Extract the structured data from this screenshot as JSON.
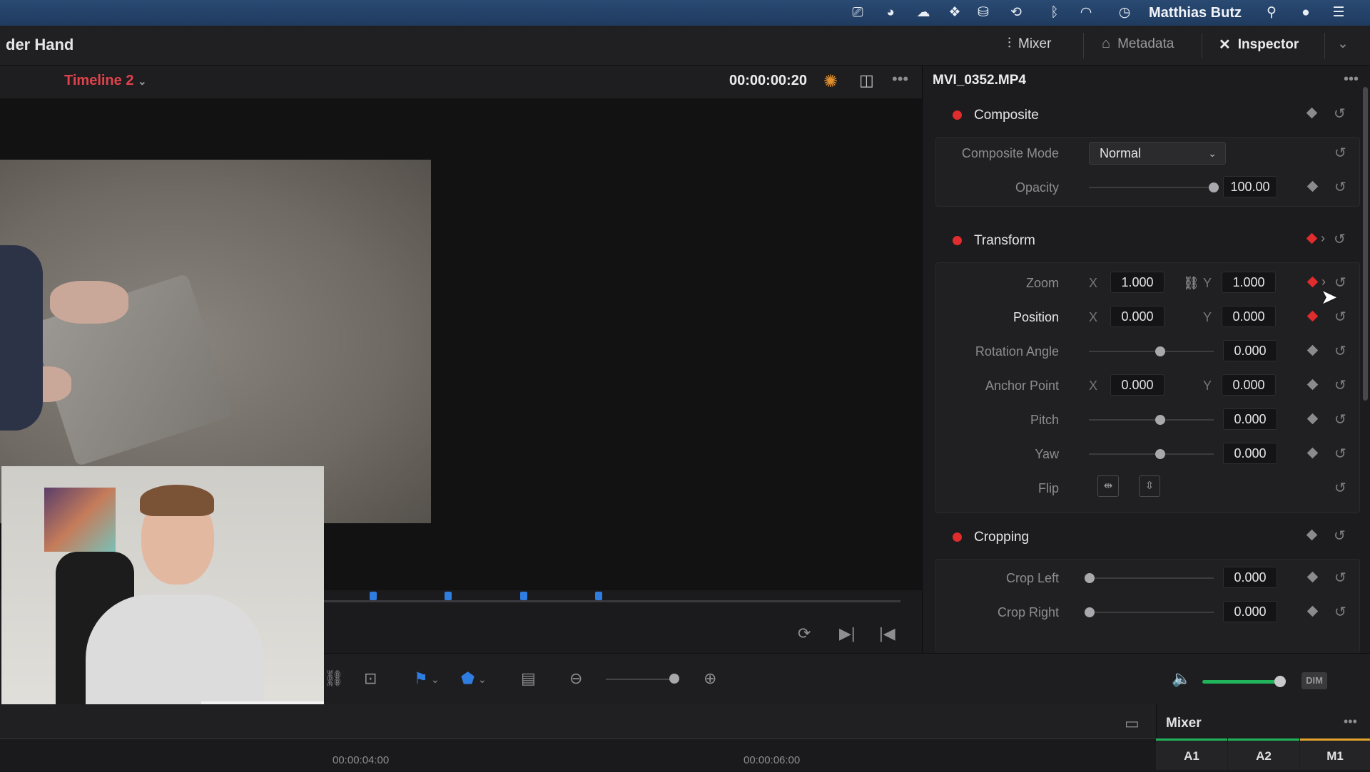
{
  "menubar": {
    "user_name": "Matthias Butz",
    "icons": [
      "screen-record-icon",
      "pacman-icon",
      "creative-cloud-icon",
      "dropbox-icon",
      "drive-icon",
      "time-machine-icon",
      "bluetooth-icon",
      "wifi-icon",
      "clock-icon",
      "search-icon",
      "siri-icon",
      "menu-list-icon"
    ]
  },
  "header": {
    "project_title": "der Hand",
    "mixer_label": "Mixer",
    "metadata_label": "Metadata",
    "inspector_label": "Inspector"
  },
  "viewer": {
    "timeline_name": "Timeline 2",
    "timecode": "00:00:00:20"
  },
  "inspector": {
    "clip_name": "MVI_0352.MP4",
    "composite": {
      "title": "Composite",
      "mode_label": "Composite Mode",
      "mode_value": "Normal",
      "opacity_label": "Opacity",
      "opacity_value": "100.00",
      "opacity_level": 1.0
    },
    "transform": {
      "title": "Transform",
      "zoom_label": "Zoom",
      "zoom_x": "1.000",
      "zoom_y": "1.000",
      "position_label": "Position",
      "position_x": "0.000",
      "position_y": "0.000",
      "rotation_label": "Rotation Angle",
      "rotation_value": "0.000",
      "anchor_label": "Anchor Point",
      "anchor_x": "0.000",
      "anchor_y": "0.000",
      "pitch_label": "Pitch",
      "pitch_value": "0.000",
      "yaw_label": "Yaw",
      "yaw_value": "0.000",
      "flip_label": "Flip",
      "axis_x": "X",
      "axis_y": "Y"
    },
    "cropping": {
      "title": "Cropping",
      "crop_left_label": "Crop Left",
      "crop_left_value": "0.000",
      "crop_right_label": "Crop Right",
      "crop_right_value": "0.000"
    }
  },
  "timeline": {
    "tc_1": "00:00:04:00",
    "tc_2": "00:00:06:00"
  },
  "audio": {
    "dim_label": "DIM",
    "volume_level": 0.95
  },
  "mixer": {
    "title": "Mixer",
    "channels": [
      "A1",
      "A2",
      "M1"
    ]
  },
  "colors": {
    "accent_red": "#e02c2c",
    "timeline_name": "#e0424b",
    "marker_blue": "#2f7de1",
    "volume_green": "#21b35a"
  }
}
